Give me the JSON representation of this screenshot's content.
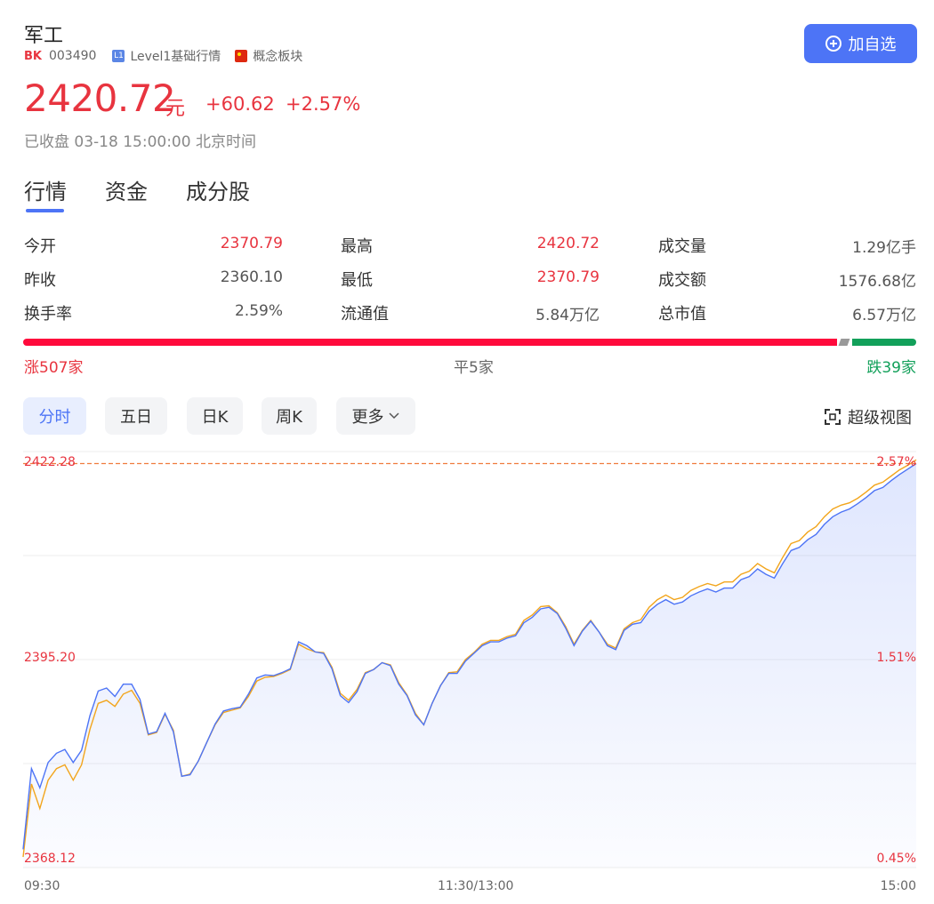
{
  "header": {
    "title": "军工",
    "bk_tag": "BK",
    "code": "003490",
    "level_badge": "L1",
    "level_text": "Level1基础行情",
    "concept_text": "概念板块",
    "add_button": "加自选"
  },
  "quote": {
    "price": "2420.72",
    "unit": "元",
    "change": "+60.62",
    "change_pct": "+2.57%",
    "status": "已收盘 03-18 15:00:00 北京时间"
  },
  "tabs": [
    "行情",
    "资金",
    "成分股"
  ],
  "stats": [
    {
      "label": "今开",
      "value": "2370.79",
      "color": "red"
    },
    {
      "label": "最高",
      "value": "2420.72",
      "color": "red"
    },
    {
      "label": "成交量",
      "value": "1.29亿手",
      "color": "gray"
    },
    {
      "label": "昨收",
      "value": "2360.10",
      "color": "gray"
    },
    {
      "label": "最低",
      "value": "2370.79",
      "color": "red"
    },
    {
      "label": "成交额",
      "value": "1576.68亿",
      "color": "gray"
    },
    {
      "label": "换手率",
      "value": "2.59%",
      "color": "gray"
    },
    {
      "label": "流通值",
      "value": "5.84万亿",
      "color": "gray"
    },
    {
      "label": "总市值",
      "value": "6.57万亿",
      "color": "gray"
    }
  ],
  "breadth": {
    "up": "涨507家",
    "flat": "平5家",
    "down": "跌39家",
    "up_count": 507,
    "flat_count": 5,
    "down_count": 39
  },
  "period_chips": [
    "分时",
    "五日",
    "日K",
    "周K",
    "更多"
  ],
  "super_view": "超级视图",
  "colors": {
    "up": "#e8343f",
    "down": "#12a05a",
    "accent": "#4d74f6",
    "avg_line": "#f2a51c"
  },
  "chart_data": {
    "type": "line",
    "y_ticks_left": [
      "2422.28",
      "2395.20",
      "2368.12"
    ],
    "y_ticks_right": [
      "2.57%",
      "1.51%",
      "0.45%"
    ],
    "x_ticks": [
      "09:30",
      "11:30/13:00",
      "15:00"
    ],
    "ylim": [
      2368.12,
      2422.28
    ],
    "reference_high": 2420.72,
    "series": [
      {
        "color": "#4d74f6",
        "values": [
          2370.5,
          2381.0,
          2378.5,
          2381.8,
          2383.0,
          2383.5,
          2381.8,
          2383.4,
          2387.9,
          2391.1,
          2391.5,
          2390.4,
          2392.0,
          2392.0,
          2390.0,
          2385.5,
          2385.8,
          2388.2,
          2385.8,
          2380.0,
          2380.2,
          2382.0,
          2384.4,
          2386.8,
          2388.5,
          2388.8,
          2389.0,
          2390.7,
          2392.8,
          2393.2,
          2393.1,
          2393.5,
          2394.0,
          2397.5,
          2397.0,
          2396.2,
          2396.0,
          2394.0,
          2390.5,
          2389.6,
          2391.0,
          2393.4,
          2393.9,
          2394.8,
          2394.4,
          2392.0,
          2390.5,
          2388.0,
          2386.7,
          2389.5,
          2391.8,
          2393.4,
          2393.4,
          2395.0,
          2396.0,
          2397.0,
          2397.5,
          2397.5,
          2398.0,
          2398.3,
          2400.0,
          2400.7,
          2401.8,
          2402.0,
          2401.2,
          2399.3,
          2397.0,
          2398.9,
          2400.2,
          2398.8,
          2397.0,
          2396.5,
          2399.0,
          2399.8,
          2400.0,
          2401.5,
          2402.4,
          2403.0,
          2402.4,
          2402.7,
          2403.5,
          2404.0,
          2404.4,
          2404.0,
          2404.5,
          2404.5,
          2405.6,
          2406.0,
          2407.0,
          2406.3,
          2405.8,
          2407.7,
          2409.4,
          2409.8,
          2410.8,
          2411.5,
          2412.8,
          2413.8,
          2414.4,
          2414.8,
          2415.5,
          2416.3,
          2417.2,
          2417.6,
          2418.5,
          2419.3,
          2420.0,
          2420.72
        ]
      },
      {
        "color": "#f2a51c",
        "values": [
          2369.5,
          2379.0,
          2375.8,
          2379.5,
          2381.0,
          2381.5,
          2379.5,
          2381.5,
          2386.1,
          2389.5,
          2389.9,
          2389.1,
          2390.7,
          2391.2,
          2389.5,
          2385.4,
          2385.7,
          2388.1,
          2386.0,
          2380.0,
          2380.3,
          2382.0,
          2384.4,
          2386.7,
          2388.3,
          2388.6,
          2388.9,
          2390.4,
          2392.4,
          2392.9,
          2393.0,
          2393.4,
          2393.9,
          2397.2,
          2396.6,
          2396.2,
          2396.1,
          2394.2,
          2390.8,
          2389.9,
          2391.3,
          2393.5,
          2393.9,
          2394.8,
          2394.5,
          2392.2,
          2390.6,
          2388.2,
          2386.7,
          2389.5,
          2391.8,
          2393.5,
          2393.6,
          2395.2,
          2396.1,
          2397.2,
          2397.7,
          2397.7,
          2398.2,
          2398.5,
          2400.3,
          2401.0,
          2402.1,
          2402.2,
          2401.3,
          2399.5,
          2397.2,
          2399.0,
          2400.3,
          2398.8,
          2397.2,
          2396.7,
          2399.2,
          2400.0,
          2400.4,
          2402.0,
          2403.0,
          2403.6,
          2403.0,
          2403.3,
          2404.2,
          2404.7,
          2405.1,
          2404.8,
          2405.3,
          2405.3,
          2406.3,
          2406.7,
          2407.7,
          2407.0,
          2406.5,
          2408.5,
          2410.3,
          2410.7,
          2411.8,
          2412.5,
          2413.8,
          2414.8,
          2415.3,
          2415.6,
          2416.2,
          2417.0,
          2417.9,
          2418.3,
          2419.1,
          2419.9,
          2420.5,
          2421.2
        ]
      }
    ]
  }
}
